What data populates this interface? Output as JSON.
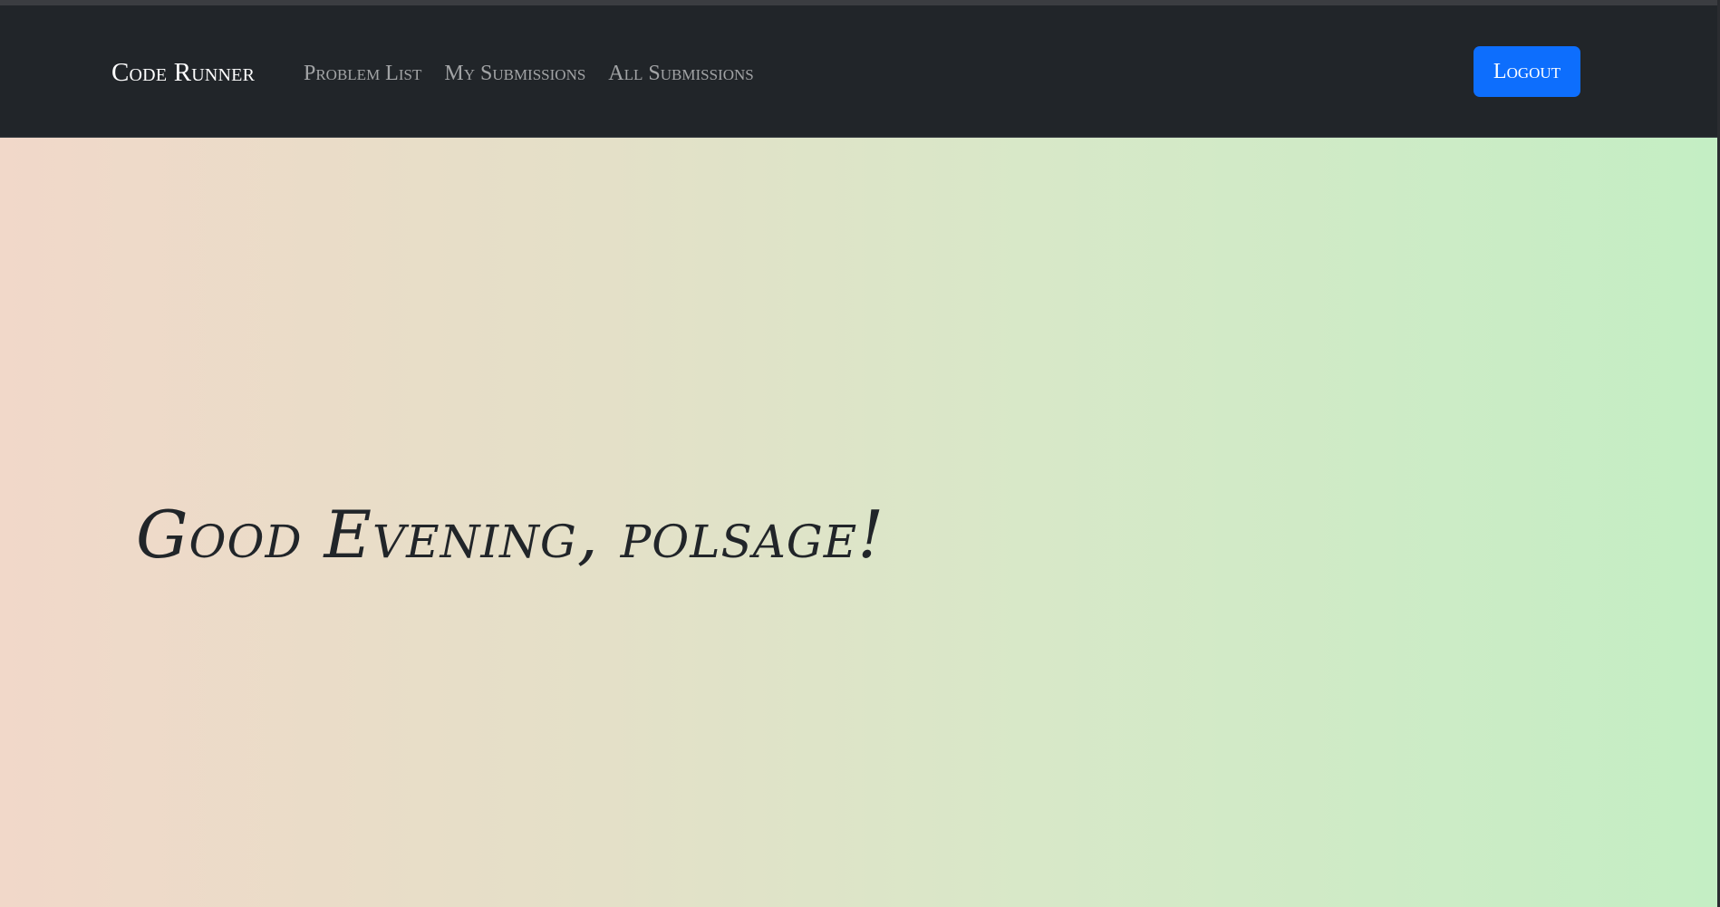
{
  "navbar": {
    "brand": "Code Runner",
    "links": [
      {
        "label": "Problem List"
      },
      {
        "label": "My Submissions"
      },
      {
        "label": "All Submissions"
      }
    ],
    "logout_label": "Logout"
  },
  "hero": {
    "greeting": "Good Evening, polsage!"
  },
  "colors": {
    "navbar_bg": "#212529",
    "accent": "#0d6efd",
    "gradient_start": "#f1d8c9",
    "gradient_end": "#c4eec4",
    "text": "#212529"
  }
}
